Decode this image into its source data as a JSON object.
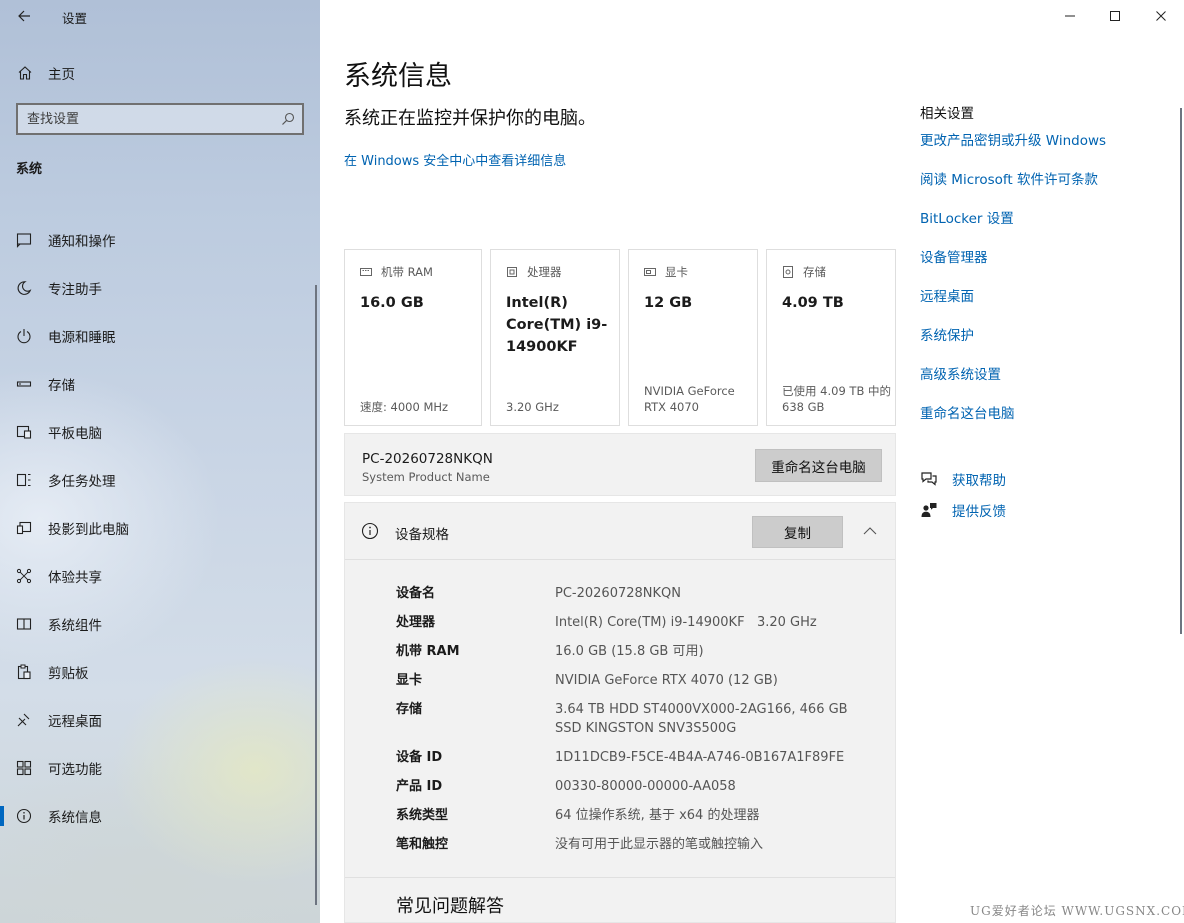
{
  "window": {
    "app_title": "设置"
  },
  "sidebar": {
    "home_label": "主页",
    "search_placeholder": "查找设置",
    "section_heading": "系统",
    "items": [
      {
        "label": "通知和操作",
        "icon": "notification-icon"
      },
      {
        "label": "专注助手",
        "icon": "moon-icon"
      },
      {
        "label": "电源和睡眠",
        "icon": "power-icon"
      },
      {
        "label": "存储",
        "icon": "storage-icon"
      },
      {
        "label": "平板电脑",
        "icon": "tablet-icon"
      },
      {
        "label": "多任务处理",
        "icon": "multitask-icon"
      },
      {
        "label": "投影到此电脑",
        "icon": "project-icon"
      },
      {
        "label": "体验共享",
        "icon": "share-icon"
      },
      {
        "label": "系统组件",
        "icon": "components-icon"
      },
      {
        "label": "剪贴板",
        "icon": "clipboard-icon"
      },
      {
        "label": "远程桌面",
        "icon": "remote-icon"
      },
      {
        "label": "可选功能",
        "icon": "apps-icon"
      },
      {
        "label": "系统信息",
        "icon": "info-icon",
        "active": true
      }
    ]
  },
  "main": {
    "title": "系统信息",
    "subtitle": "系统正在监控并保护你的电脑。",
    "security_link": "在 Windows 安全中心中查看详细信息",
    "cards": [
      {
        "header": "机带 RAM",
        "value": "16.0 GB",
        "footer": "速度: 4000 MHz",
        "icon": "ram-icon"
      },
      {
        "header": "处理器",
        "value": "Intel(R) Core(TM) i9-14900KF",
        "footer": "3.20 GHz",
        "icon": "cpu-icon"
      },
      {
        "header": "显卡",
        "value": "12 GB",
        "footer": "NVIDIA GeForce RTX 4070",
        "icon": "gpu-icon"
      },
      {
        "header": "存储",
        "value": "4.09 TB",
        "footer": "已使用 4.09 TB 中的 638 GB",
        "icon": "disk-icon"
      }
    ],
    "pc": {
      "name": "PC-20260728NKQN",
      "sub": "System Product Name",
      "rename_button": "重命名这台电脑"
    },
    "specs": {
      "title": "设备规格",
      "copy_button": "复制",
      "rows": [
        {
          "key": "设备名",
          "value": "PC-20260728NKQN"
        },
        {
          "key": "处理器",
          "value": "Intel(R) Core(TM) i9-14900KF   3.20 GHz"
        },
        {
          "key": "机带 RAM",
          "value": "16.0 GB (15.8 GB 可用)"
        },
        {
          "key": "显卡",
          "value": "NVIDIA GeForce RTX 4070 (12 GB)"
        },
        {
          "key": "存储",
          "value": "3.64 TB HDD ST4000VX000-2AG166, 466 GB SSD KINGSTON SNV3S500G"
        },
        {
          "key": "设备 ID",
          "value": "1D11DCB9-F5CE-4B4A-A746-0B167A1F89FE"
        },
        {
          "key": "产品 ID",
          "value": "00330-80000-00000-AA058"
        },
        {
          "key": "系统类型",
          "value": "64 位操作系统, 基于 x64 的处理器"
        },
        {
          "key": "笔和触控",
          "value": "没有可用于此显示器的笔或触控输入"
        }
      ],
      "faq_title": "常见问题解答"
    }
  },
  "related": {
    "title": "相关设置",
    "links": [
      "更改产品密钥或升级 Windows",
      "阅读 Microsoft 软件许可条款",
      "BitLocker 设置",
      "设备管理器",
      "远程桌面",
      "系统保护",
      "高级系统设置",
      "重命名这台电脑"
    ],
    "help": "获取帮助",
    "feedback": "提供反馈"
  },
  "watermark": "UG爱好者论坛 WWW.UGSNX.COM",
  "colors": {
    "accent": "#0067c0",
    "link": "#0063b1"
  }
}
